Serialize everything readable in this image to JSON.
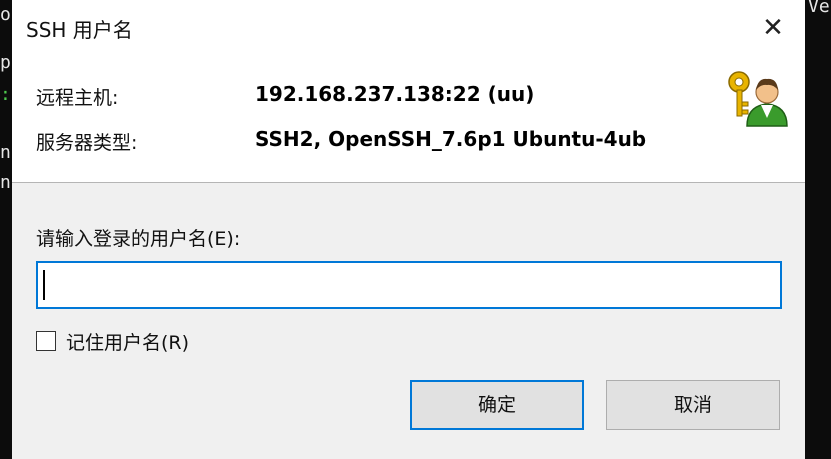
{
  "window": {
    "title": "SSH 用户名",
    "close_glyph": "✕"
  },
  "info": {
    "host_label": "远程主机:",
    "host_value": "192.168.237.138:22 (uu)",
    "server_type_label": "服务器类型:",
    "server_type_value": "SSH2, OpenSSH_7.6p1 Ubuntu-4ub",
    "icon": "key-user-icon"
  },
  "form": {
    "prompt": "请输入登录的用户名(E):",
    "username_value": "",
    "remember_label": "记住用户名(R)",
    "remember_checked": false
  },
  "buttons": {
    "ok": "确定",
    "cancel": "取消"
  },
  "terminal": {
    "left_chars": [
      "o",
      "p",
      ":",
      "n",
      "n"
    ],
    "right_chars": [
      "Ve"
    ]
  },
  "colors": {
    "accent": "#0078d7",
    "dialog_bg": "#f0f0f0",
    "panel_bg": "#ffffff"
  }
}
